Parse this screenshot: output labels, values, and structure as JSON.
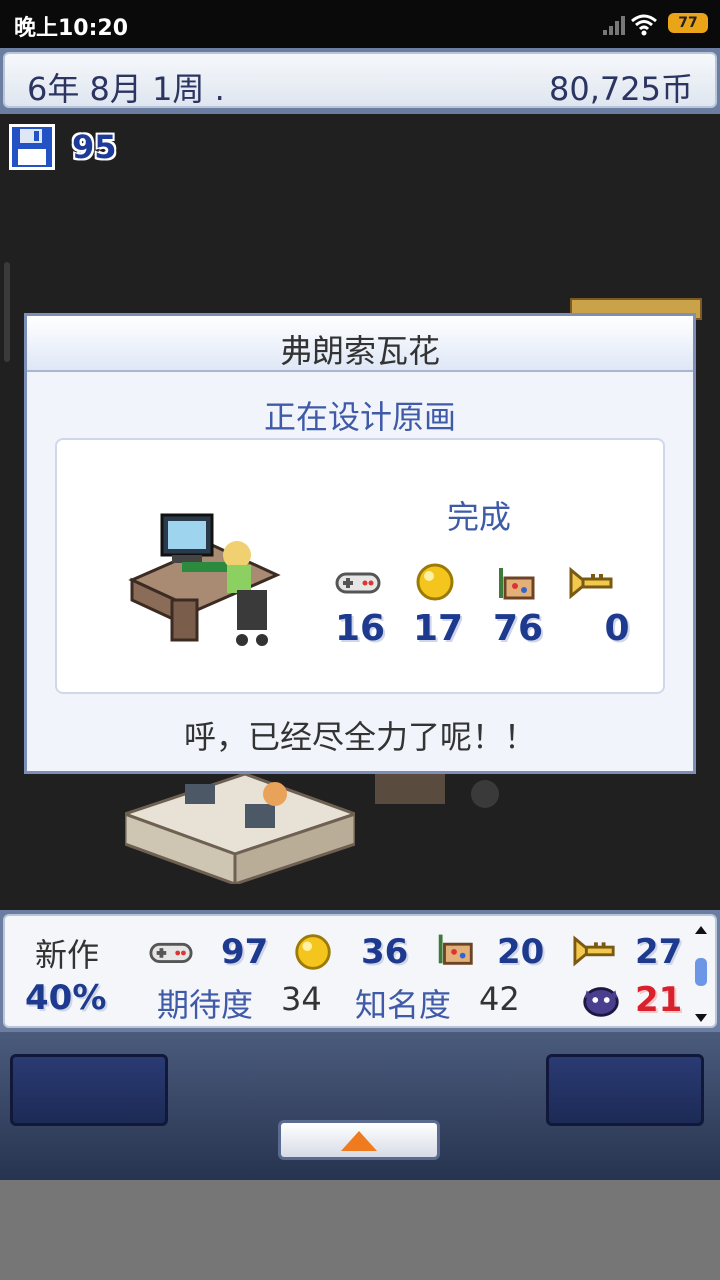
{
  "status_bar": {
    "time": "晚上10:20",
    "battery": "77"
  },
  "top_bar": {
    "date": "6年 8月 1周 .",
    "money": "80,725币"
  },
  "save": {
    "count": "95"
  },
  "dialog": {
    "name": "弗朗索瓦花",
    "task": "正在设计原画",
    "status": "完成",
    "stats": [
      {
        "icon": "gamepad-icon",
        "value": "16"
      },
      {
        "icon": "gold-orb-icon",
        "value": "17"
      },
      {
        "icon": "art-easel-icon",
        "value": "76"
      },
      {
        "icon": "sound-trumpet-icon",
        "value": "0"
      }
    ],
    "message": "呼，已经尽全力了呢！！"
  },
  "bottom_panel": {
    "new_label": "新作",
    "progress": "40%",
    "fun": "97",
    "creativity": "36",
    "graphics": "20",
    "sound": "27",
    "expectation_label": "期待度",
    "expectation": "34",
    "fame_label": "知名度",
    "fame": "42",
    "bugs": "21"
  },
  "colors": {
    "accent_blue": "#1d3a8f",
    "bug_red": "#d8212c",
    "frame": "#7d8fb8"
  }
}
